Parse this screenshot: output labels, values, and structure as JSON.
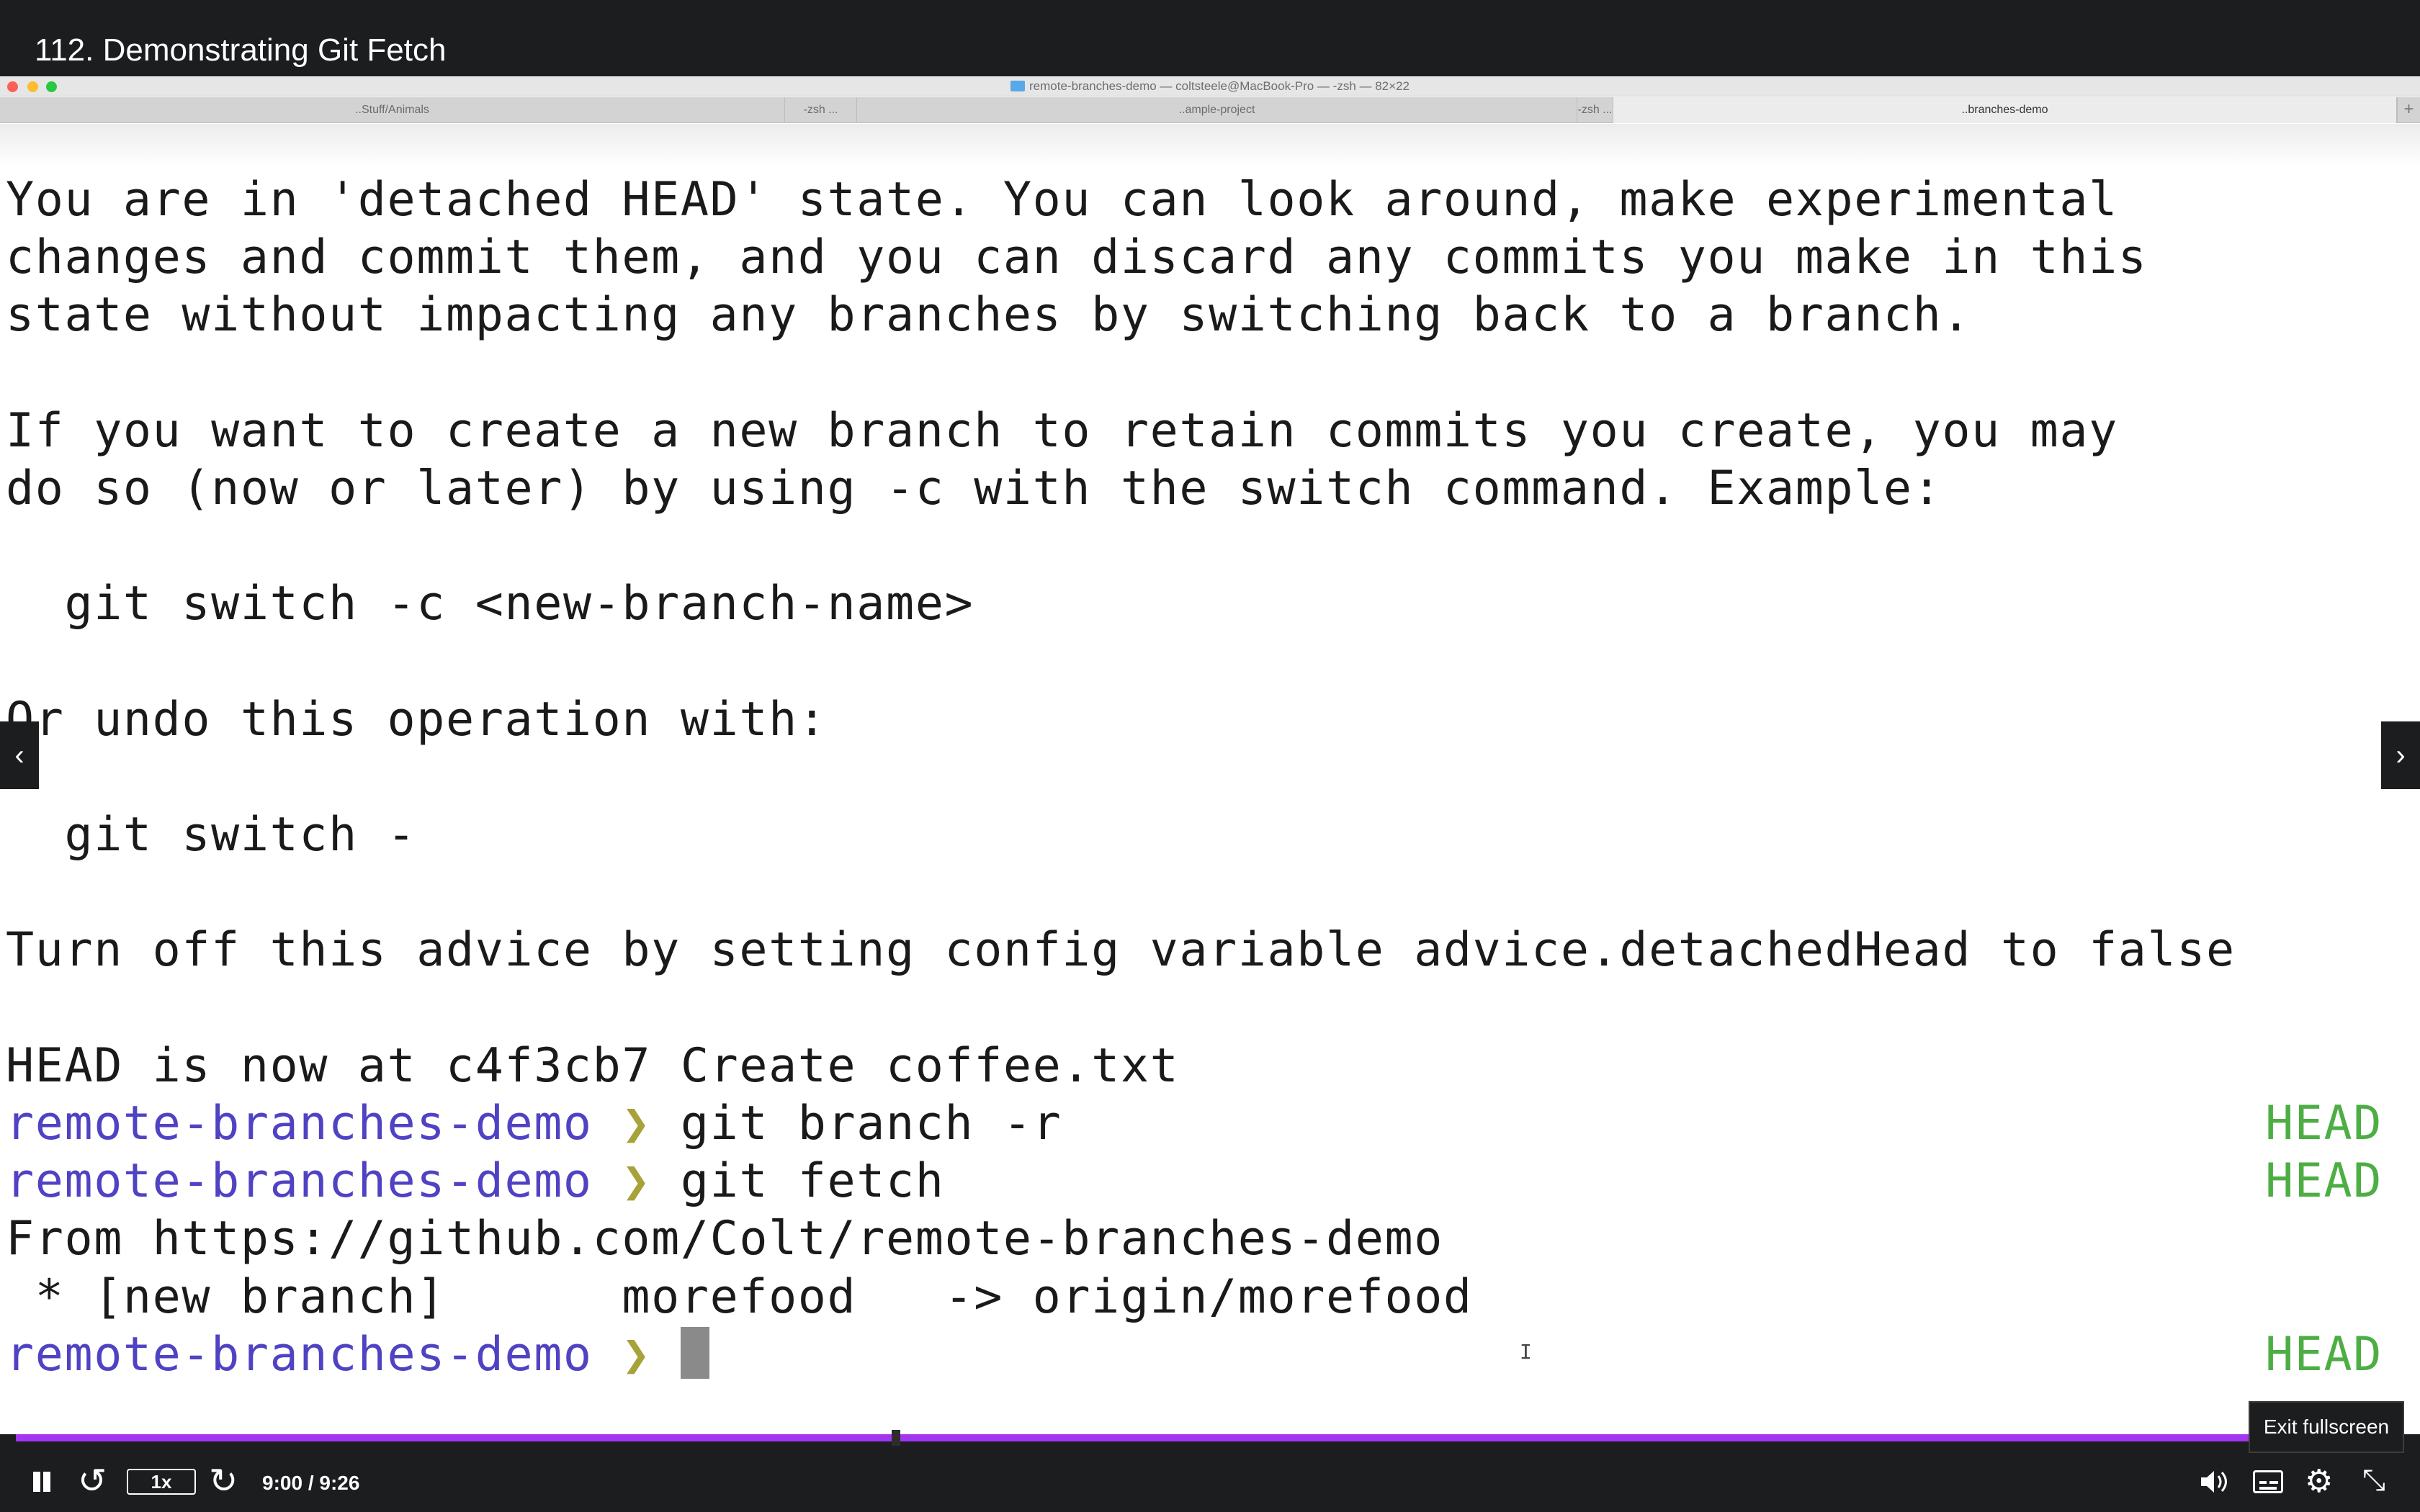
{
  "video": {
    "title": "112. Demonstrating Git Fetch"
  },
  "window": {
    "title": "remote-branches-demo — coltsteele@MacBook-Pro — -zsh — 82×22",
    "colors": {
      "close": "#fe5f57",
      "minimize": "#febc2e",
      "zoom": "#28c840"
    }
  },
  "tabs": [
    {
      "label": "..Stuff/Animals"
    },
    {
      "label": "-zsh ..."
    },
    {
      "label": "..ample-project"
    },
    {
      "label": "-zsh ..."
    },
    {
      "label": "..branches-demo"
    }
  ],
  "terminal": {
    "text_lines": {
      "0": "You are in 'detached HEAD' state. You can look around, make experimental",
      "1": "changes and commit them, and you can discard any commits you make in this",
      "2": "state without impacting any branches by switching back to a branch.",
      "4": "If you want to create a new branch to retain commits you create, you may",
      "5": "do so (now or later) by using -c with the switch command. Example:",
      "7": "  git switch -c <new-branch-name>",
      "9": "Or undo this operation with:",
      "11": "  git switch -",
      "13": "Turn off this advice by setting config variable advice.detachedHead to false",
      "15": "HEAD is now at c4f3cb7 Create coffee.txt",
      "18": "From https://github.com/Colt/remote-branches-demo",
      "19": " * [new branch]      morefood   -> origin/morefood"
    },
    "prompt_dir": "remote-branches-demo",
    "prompt_arrow": "❯",
    "head_tag": "HEAD",
    "commands": {
      "16": "git branch -r",
      "17": "git fetch",
      "20": ""
    },
    "colors": {
      "prompt_dir": "#4f43c3",
      "prompt_arrow": "#a8a23a",
      "head_tag": "#4cae43"
    }
  },
  "player": {
    "progress": 0.951,
    "accent_color": "#a435f0",
    "speed_label": "1x",
    "time_display": "9:00 / 9:26",
    "tooltip": "Exit fullscreen",
    "icons": {
      "prev": "chevron-left-icon",
      "next": "chevron-right-icon",
      "pause": "pause-icon",
      "rewind": "rewind-icon",
      "forward": "forward-icon",
      "volume": "volume-icon",
      "captions": "captions-icon",
      "settings": "gear-icon",
      "exit_fullscreen": "exit-fullscreen-icon"
    }
  }
}
